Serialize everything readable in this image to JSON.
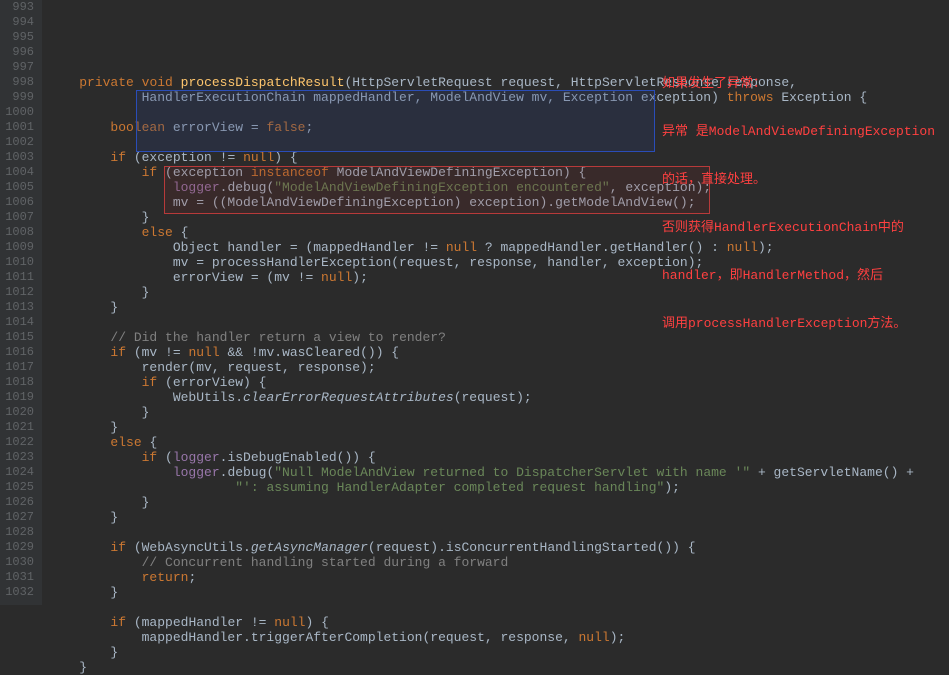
{
  "gutter": {
    "start": 993,
    "end": 1032
  },
  "code_lines": {
    "l993": {
      "indent": 1,
      "tokens": [
        [
          "kw",
          "private"
        ],
        [
          "",
          " "
        ],
        [
          "kw",
          "void"
        ],
        [
          "",
          " "
        ],
        [
          "method",
          "processDispatchResult"
        ],
        [
          "",
          "(HttpServletRequest request, HttpServletResponse response,"
        ]
      ]
    },
    "l994": {
      "indent": 3,
      "tokens": [
        [
          "",
          "HandlerExecutionChain mappedHandler, ModelAndView mv, Exception exception) "
        ],
        [
          "kw",
          "throws"
        ],
        [
          "",
          " Exception {"
        ]
      ]
    },
    "l995": {
      "indent": 0,
      "tokens": []
    },
    "l996": {
      "indent": 2,
      "tokens": [
        [
          "kw",
          "boolean"
        ],
        [
          "",
          " errorView = "
        ],
        [
          "kw",
          "false"
        ],
        [
          "",
          ";"
        ]
      ]
    },
    "l997": {
      "indent": 0,
      "tokens": []
    },
    "l998": {
      "indent": 2,
      "tokens": [
        [
          "kw",
          "if"
        ],
        [
          "",
          " (exception != "
        ],
        [
          "kw",
          "null"
        ],
        [
          "",
          ") {"
        ]
      ]
    },
    "l999": {
      "indent": 3,
      "tokens": [
        [
          "kw",
          "if"
        ],
        [
          "",
          " (exception "
        ],
        [
          "kw",
          "instanceof"
        ],
        [
          "",
          " ModelAndViewDefiningException) {"
        ]
      ]
    },
    "l1000": {
      "indent": 4,
      "tokens": [
        [
          "field",
          "logger"
        ],
        [
          "",
          ".debug("
        ],
        [
          "str",
          "\"ModelAndViewDefiningException encountered\""
        ],
        [
          "",
          ", exception);"
        ]
      ]
    },
    "l1001": {
      "indent": 4,
      "tokens": [
        [
          "",
          "mv = ((ModelAndViewDefiningException) exception).getModelAndView();"
        ]
      ]
    },
    "l1002": {
      "indent": 3,
      "tokens": [
        [
          "",
          "}"
        ]
      ]
    },
    "l1003": {
      "indent": 3,
      "tokens": [
        [
          "kw",
          "else"
        ],
        [
          "",
          " {"
        ]
      ]
    },
    "l1004": {
      "indent": 4,
      "tokens": [
        [
          "",
          "Object handler = (mappedHandler != "
        ],
        [
          "kw",
          "null"
        ],
        [
          "",
          " ? mappedHandler.getHandler() : "
        ],
        [
          "kw",
          "null"
        ],
        [
          "",
          ");"
        ]
      ]
    },
    "l1005": {
      "indent": 4,
      "tokens": [
        [
          "",
          "mv = processHandlerException(request, response, handler, exception);"
        ]
      ]
    },
    "l1006": {
      "indent": 4,
      "tokens": [
        [
          "",
          "errorView = (mv != "
        ],
        [
          "kw",
          "null"
        ],
        [
          "",
          ");"
        ]
      ]
    },
    "l1007": {
      "indent": 3,
      "tokens": [
        [
          "",
          "}"
        ]
      ]
    },
    "l1008": {
      "indent": 2,
      "tokens": [
        [
          "",
          "}"
        ]
      ]
    },
    "l1009": {
      "indent": 0,
      "tokens": []
    },
    "l1010": {
      "indent": 2,
      "tokens": [
        [
          "comment",
          "// Did the handler return a view to render?"
        ]
      ]
    },
    "l1011": {
      "indent": 2,
      "tokens": [
        [
          "kw",
          "if"
        ],
        [
          "",
          " (mv != "
        ],
        [
          "kw",
          "null"
        ],
        [
          "",
          " && !mv.wasCleared()) {"
        ]
      ]
    },
    "l1012": {
      "indent": 3,
      "tokens": [
        [
          "",
          "render(mv, request, response);"
        ]
      ]
    },
    "l1013": {
      "indent": 3,
      "tokens": [
        [
          "kw",
          "if"
        ],
        [
          "",
          " (errorView) {"
        ]
      ]
    },
    "l1014": {
      "indent": 4,
      "tokens": [
        [
          "",
          "WebUtils."
        ],
        [
          "it",
          "clearErrorRequestAttributes"
        ],
        [
          "",
          "(request);"
        ]
      ]
    },
    "l1015": {
      "indent": 3,
      "tokens": [
        [
          "",
          "}"
        ]
      ]
    },
    "l1016": {
      "indent": 2,
      "tokens": [
        [
          "",
          "}"
        ]
      ]
    },
    "l1017": {
      "indent": 2,
      "tokens": [
        [
          "kw",
          "else"
        ],
        [
          "",
          " {"
        ]
      ]
    },
    "l1018": {
      "indent": 3,
      "tokens": [
        [
          "kw",
          "if"
        ],
        [
          "",
          " ("
        ],
        [
          "field",
          "logger"
        ],
        [
          "",
          ".isDebugEnabled()) {"
        ]
      ]
    },
    "l1019": {
      "indent": 4,
      "tokens": [
        [
          "field",
          "logger"
        ],
        [
          "",
          ".debug("
        ],
        [
          "str",
          "\"Null ModelAndView returned to DispatcherServlet with name '\""
        ],
        [
          "",
          " + getServletName() +"
        ]
      ]
    },
    "l1020": {
      "indent": 6,
      "tokens": [
        [
          "str",
          "\"': assuming HandlerAdapter completed request handling\""
        ],
        [
          "",
          ");"
        ]
      ]
    },
    "l1021": {
      "indent": 3,
      "tokens": [
        [
          "",
          "}"
        ]
      ]
    },
    "l1022": {
      "indent": 2,
      "tokens": [
        [
          "",
          "}"
        ]
      ]
    },
    "l1023": {
      "indent": 0,
      "tokens": []
    },
    "l1024": {
      "indent": 2,
      "tokens": [
        [
          "kw",
          "if"
        ],
        [
          "",
          " (WebAsyncUtils."
        ],
        [
          "it",
          "getAsyncManager"
        ],
        [
          "",
          "(request).isConcurrentHandlingStarted()) {"
        ]
      ]
    },
    "l1025": {
      "indent": 3,
      "tokens": [
        [
          "comment",
          "// Concurrent handling started during a forward"
        ]
      ]
    },
    "l1026": {
      "indent": 3,
      "tokens": [
        [
          "kw",
          "return"
        ],
        [
          "",
          ";"
        ]
      ]
    },
    "l1027": {
      "indent": 2,
      "tokens": [
        [
          "",
          "}"
        ]
      ]
    },
    "l1028": {
      "indent": 0,
      "tokens": []
    },
    "l1029": {
      "indent": 2,
      "tokens": [
        [
          "kw",
          "if"
        ],
        [
          "",
          " (mappedHandler != "
        ],
        [
          "kw",
          "null"
        ],
        [
          "",
          ") {"
        ]
      ]
    },
    "l1030": {
      "indent": 3,
      "tokens": [
        [
          "",
          "mappedHandler.triggerAfterCompletion(request, response, "
        ],
        [
          "kw",
          "null"
        ],
        [
          "",
          ");"
        ]
      ]
    },
    "l1031": {
      "indent": 2,
      "tokens": [
        [
          "",
          "}"
        ]
      ]
    },
    "l1032": {
      "indent": 1,
      "tokens": [
        [
          "",
          "}"
        ]
      ]
    }
  },
  "annotation": {
    "l1": "如果发生了异常：",
    "l2": "异常 是ModelAndViewDefiningException",
    "l3": "的话，直接处理。",
    "l4": "否则获得HandlerExecutionChain中的",
    "l5": "handler，即HandlerMethod，然后",
    "l6": "调用processHandlerException方法。"
  }
}
